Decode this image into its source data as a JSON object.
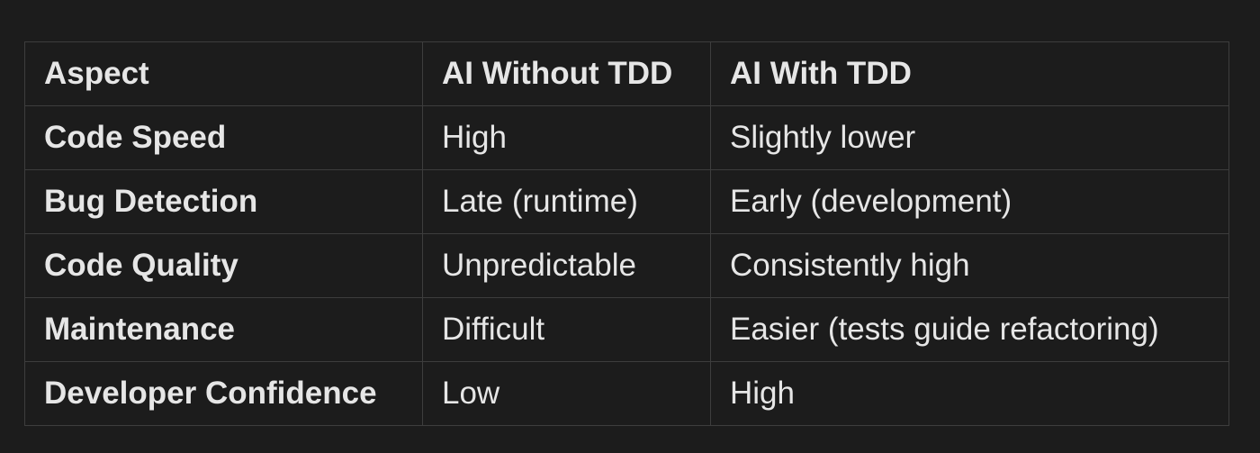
{
  "table": {
    "headers": [
      "Aspect",
      "AI Without TDD",
      "AI With TDD"
    ],
    "rows": [
      [
        "Code Speed",
        "High",
        "Slightly lower"
      ],
      [
        "Bug Detection",
        "Late (runtime)",
        "Early (development)"
      ],
      [
        "Code Quality",
        "Unpredictable",
        "Consistently high"
      ],
      [
        "Maintenance",
        "Difficult",
        "Easier (tests guide refactoring)"
      ],
      [
        "Developer Confidence",
        "Low",
        "High"
      ]
    ]
  }
}
